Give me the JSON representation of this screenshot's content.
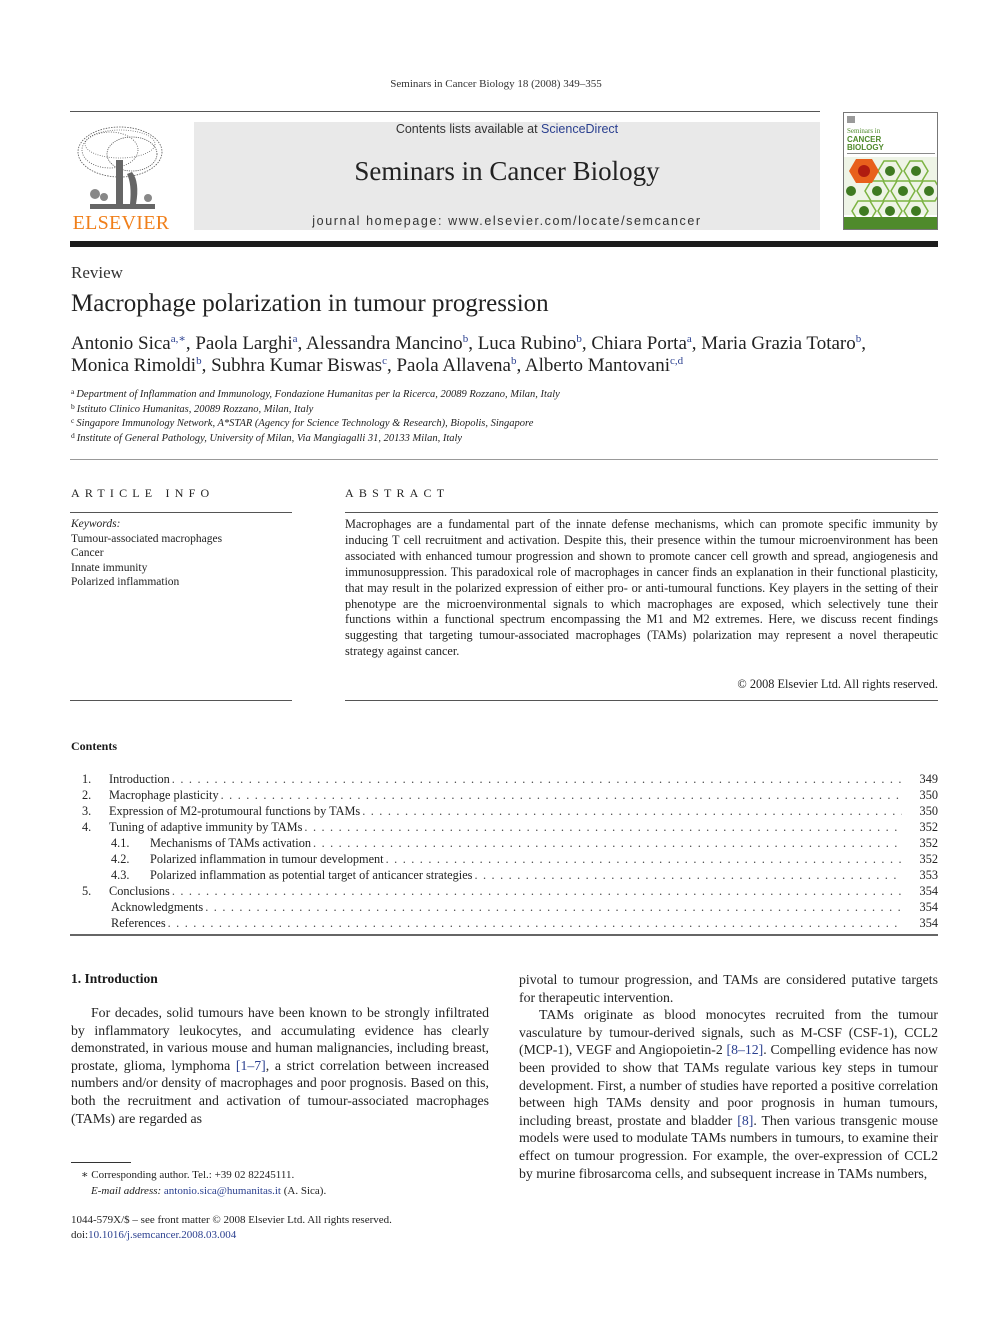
{
  "running_head": "Seminars in Cancer Biology 18 (2008) 349–355",
  "header": {
    "publisher_wordmark": "ELSEVIER",
    "contents_available_prefix": "Contents lists available at ",
    "contents_available_link": "ScienceDirect",
    "journal_title": "Seminars in Cancer Biology",
    "homepage": "journal homepage: www.elsevier.com/locate/semcancer",
    "cover": {
      "series_label": "Seminars in",
      "title_line1": "CANCER",
      "title_line2": "BIOLOGY"
    },
    "colors": {
      "elsevier_orange": "#f07f1a",
      "link_blue": "#2a3f8f",
      "banner_gray": "#e9e9e9",
      "cover_green": "#4f8a2b"
    }
  },
  "article": {
    "type": "Review",
    "title": "Macrophage polarization in tumour progression",
    "authors": [
      {
        "name": "Antonio Sica",
        "sup": "a,∗",
        "sep": ", "
      },
      {
        "name": "Paola Larghi",
        "sup": "a",
        "sep": ", "
      },
      {
        "name": "Alessandra Mancino",
        "sup": "b",
        "sep": ", "
      },
      {
        "name": "Luca Rubino",
        "sup": "b",
        "sep": ", "
      },
      {
        "name": "Chiara Porta",
        "sup": "a",
        "sep": ", "
      },
      {
        "name": "Maria Grazia Totaro",
        "sup": "b",
        "sep": ","
      },
      {
        "name": "Monica Rimoldi",
        "sup": "b",
        "sep": ", "
      },
      {
        "name": "Subhra Kumar Biswas",
        "sup": "c",
        "sep": ", "
      },
      {
        "name": "Paola Allavena",
        "sup": "b",
        "sep": ", "
      },
      {
        "name": "Alberto Mantovani",
        "sup": "c,d",
        "sep": ""
      }
    ],
    "affiliations": [
      {
        "key": "a",
        "text": "Department of Inflammation and Immunology, Fondazione Humanitas per la Ricerca, 20089 Rozzano, Milan, Italy"
      },
      {
        "key": "b",
        "text": "Istituto Clinico Humanitas, 20089 Rozzano, Milan, Italy"
      },
      {
        "key": "c",
        "text": "Singapore Immunology Network, A*STAR (Agency for Science Technology & Research), Biopolis, Singapore"
      },
      {
        "key": "d",
        "text": "Institute of General Pathology, University of Milan, Via Mangiagalli 31, 20133 Milan, Italy"
      }
    ]
  },
  "article_info": {
    "heading": "ARTICLE INFO",
    "keywords_label": "Keywords:",
    "keywords": [
      "Tumour-associated macrophages",
      "Cancer",
      "Innate immunity",
      "Polarized inflammation"
    ]
  },
  "abstract": {
    "heading": "ABSTRACT",
    "text": "Macrophages are a fundamental part of the innate defense mechanisms, which can promote specific immunity by inducing T cell recruitment and activation. Despite this, their presence within the tumour microenvironment has been associated with enhanced tumour progression and shown to promote cancer cell growth and spread, angiogenesis and immunosuppression. This paradoxical role of macrophages in cancer finds an explanation in their functional plasticity, that may result in the polarized expression of either pro- or anti-tumoural functions. Key players in the setting of their phenotype are the microenvironmental signals to which macrophages are exposed, which selectively tune their functions within a functional spectrum encompassing the M1 and M2 extremes. Here, we discuss recent findings suggesting that targeting tumour-associated macrophages (TAMs) polarization may represent a novel therapeutic strategy against cancer.",
    "copyright": "© 2008 Elsevier Ltd. All rights reserved."
  },
  "contents": {
    "heading": "Contents",
    "entries": [
      {
        "num": "1.",
        "title": "Introduction",
        "page": "349",
        "level": 1
      },
      {
        "num": "2.",
        "title": "Macrophage plasticity",
        "page": "350",
        "level": 1
      },
      {
        "num": "3.",
        "title": "Expression of M2-protumoural functions by TAMs",
        "page": "350",
        "level": 1
      },
      {
        "num": "4.",
        "title": "Tuning of adaptive immunity by TAMs",
        "page": "352",
        "level": 1
      },
      {
        "num": "4.1.",
        "title": "Mechanisms of TAMs activation",
        "page": "352",
        "level": 2
      },
      {
        "num": "4.2.",
        "title": "Polarized inflammation in tumour development",
        "page": "352",
        "level": 2
      },
      {
        "num": "4.3.",
        "title": "Polarized inflammation as potential target of anticancer strategies",
        "page": "353",
        "level": 2
      },
      {
        "num": "5.",
        "title": "Conclusions",
        "page": "354",
        "level": 1
      },
      {
        "num": "",
        "title": "Acknowledgments",
        "page": "354",
        "level": 0
      },
      {
        "num": "",
        "title": "References",
        "page": "354",
        "level": 0
      }
    ]
  },
  "body": {
    "intro_heading": "1.  Introduction",
    "left_para": {
      "before_ref": "For decades, solid tumours have been known to be strongly infiltrated by inflammatory leukocytes, and accumulating evidence has clearly demonstrated, in various mouse and human malignancies, including breast, prostate, glioma, lymphoma ",
      "ref": "[1–7]",
      "after_ref": ", a strict correlation between increased numbers and/or density of macrophages and poor prognosis. Based on this, both the recruitment and activation of tumour-associated macrophages (TAMs) are regarded as"
    },
    "right_para1": "pivotal to tumour progression, and TAMs are considered putative targets for therapeutic intervention.",
    "right_para2": {
      "part1": "TAMs originate as blood monocytes recruited from the tumour vasculature by tumour-derived signals, such as M-CSF (CSF-1), CCL2 (MCP-1), VEGF and Angiopoietin-2 ",
      "ref1": "[8–12]",
      "part2": ". Compelling evidence has now been provided to show that TAMs regulate various key steps in tumour development. First, a number of studies have reported a positive correlation between high TAMs density and poor prognosis in human tumours, including breast, prostate and bladder ",
      "ref2": "[8]",
      "part3": ". Then various transgenic mouse models were used to modulate TAMs numbers in tumours, to examine their effect on tumour progression. For example, the over-expression of CCL2 by murine fibrosarcoma cells, and subsequent increase in TAMs numbers,"
    }
  },
  "footnotes": {
    "corresponding": "∗  Corresponding author. Tel.: +39 02 82245111.",
    "email_label": "E-mail address:",
    "email": "antonio.sica@humanitas.it",
    "email_suffix": " (A. Sica).",
    "issn_line": "1044-579X/$ – see front matter © 2008 Elsevier Ltd. All rights reserved.",
    "doi_label": "doi:",
    "doi": "10.1016/j.semcancer.2008.03.004"
  }
}
